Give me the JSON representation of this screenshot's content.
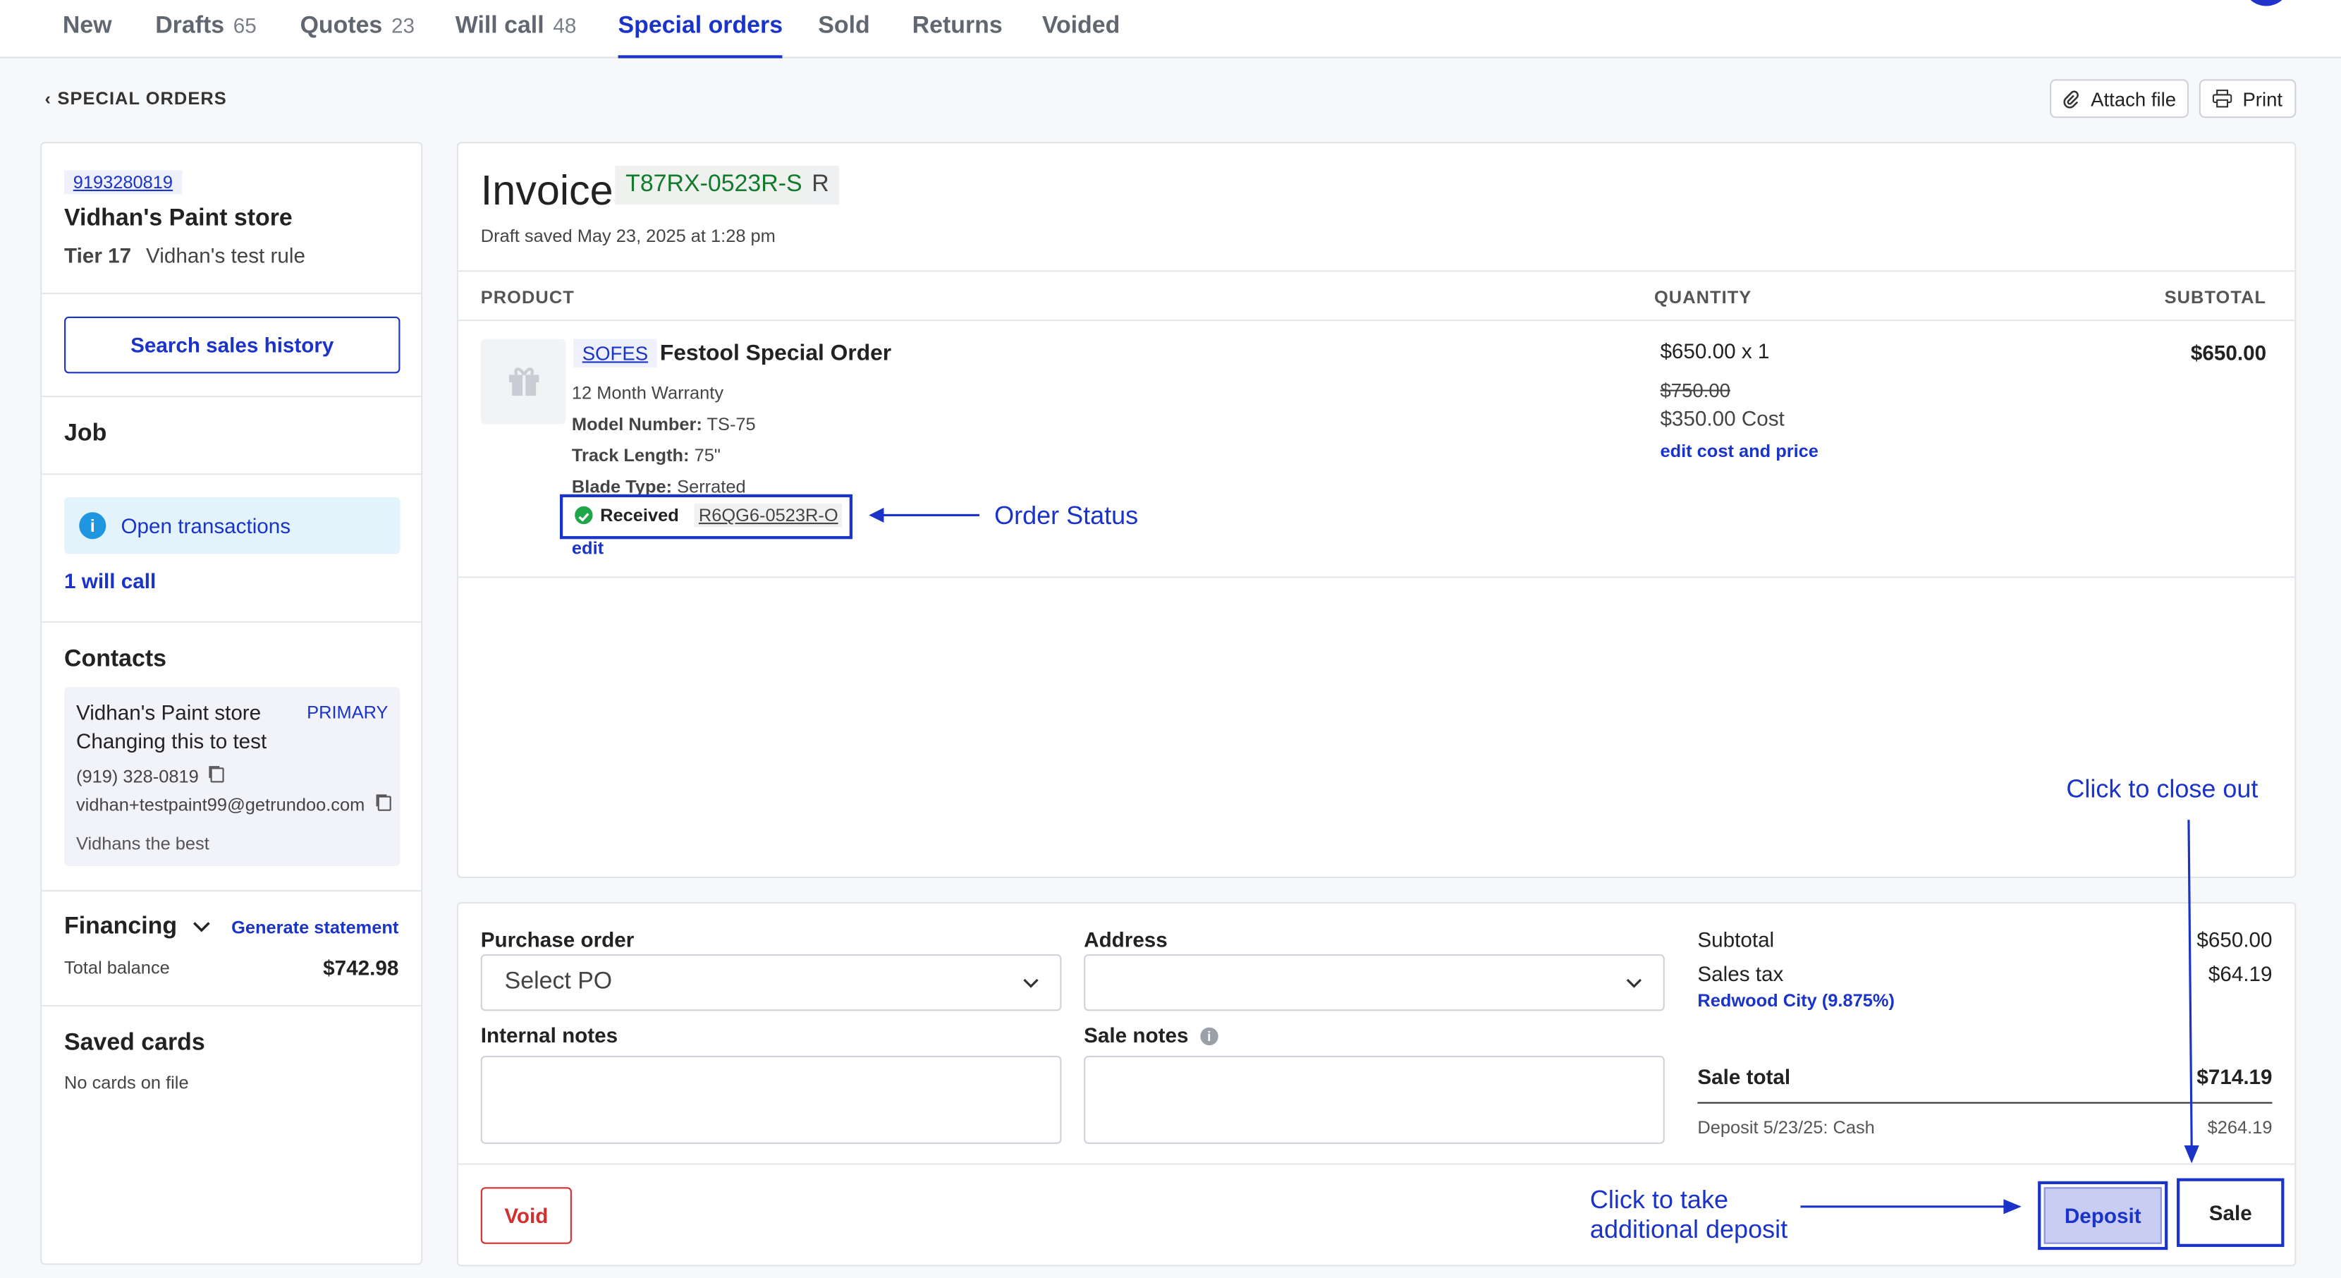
{
  "tabs": [
    {
      "label": "New",
      "count": ""
    },
    {
      "label": "Drafts",
      "count": "65"
    },
    {
      "label": "Quotes",
      "count": "23"
    },
    {
      "label": "Will call",
      "count": "48"
    },
    {
      "label": "Special orders",
      "count": ""
    },
    {
      "label": "Sold",
      "count": ""
    },
    {
      "label": "Returns",
      "count": ""
    },
    {
      "label": "Voided",
      "count": ""
    }
  ],
  "breadcrumb": "SPECIAL ORDERS",
  "toolbar": {
    "attach": "Attach file",
    "print": "Print"
  },
  "customer": {
    "phone": "9193280819",
    "name": "Vidhan's Paint store",
    "tier": "Tier 17",
    "rule": "Vidhan's test rule",
    "search_history": "Search sales history"
  },
  "job": {
    "title": "Job",
    "open_transactions": "Open transactions",
    "will_call": "1 will call"
  },
  "contacts": {
    "title": "Contacts",
    "name": "Vidhan's Paint store",
    "primary": "PRIMARY",
    "subtitle": "Changing this to test",
    "phone": "(919) 328-0819",
    "email": "vidhan+testpaint99@getrundoo.com",
    "note": "Vidhans the best"
  },
  "financing": {
    "title": "Financing",
    "generate": "Generate statement",
    "balance_label": "Total balance",
    "balance": "$742.98"
  },
  "saved_cards": {
    "title": "Saved cards",
    "empty": "No cards on file"
  },
  "invoice": {
    "title": "Invoice",
    "number": "T87RX-0523R-S",
    "badge": "R",
    "saved": "Draft saved May 23, 2025 at 1:28 pm",
    "col_product": "PRODUCT",
    "col_quantity": "QUANTITY",
    "col_subtotal": "SUBTOTAL"
  },
  "item": {
    "sku": "SOFES",
    "name": "Festool Special Order",
    "warranty": "12 Month Warranty",
    "model_label": "Model Number:",
    "model": "TS-75",
    "track_label": "Track Length:",
    "track": "75\"",
    "blade_label": "Blade Type:",
    "blade": "Serrated",
    "status": "Received",
    "po_ref": "R6QG6-0523R-O",
    "edit": "edit",
    "qty": "$650.00 x 1",
    "orig_price": "$750.00",
    "cost": "$350.00 Cost",
    "edit_cost": "edit cost and price",
    "subtotal": "$650.00"
  },
  "form": {
    "po_label": "Purchase order",
    "po_placeholder": "Select PO",
    "address_label": "Address",
    "internal_label": "Internal notes",
    "sale_notes_label": "Sale notes"
  },
  "totals": {
    "subtotal_label": "Subtotal",
    "subtotal": "$650.00",
    "tax_label": "Sales tax",
    "tax": "$64.19",
    "tax_location": "Redwood City (9.875%)",
    "total_label": "Sale total",
    "total": "$714.19",
    "deposit_label": "Deposit 5/23/25: Cash",
    "deposit": "$264.19"
  },
  "actions": {
    "void": "Void",
    "deposit": "Deposit",
    "sale": "Sale"
  },
  "annotations": {
    "order_status": "Order Status",
    "close_out": "Click to close out",
    "deposit_line1": "Click to take",
    "deposit_line2": "additional deposit"
  },
  "colors": {
    "accent": "#1a33c8",
    "invoice_green": "#137a2e",
    "void_red": "#d32f2f",
    "info_bg": "#e3f3fc"
  }
}
